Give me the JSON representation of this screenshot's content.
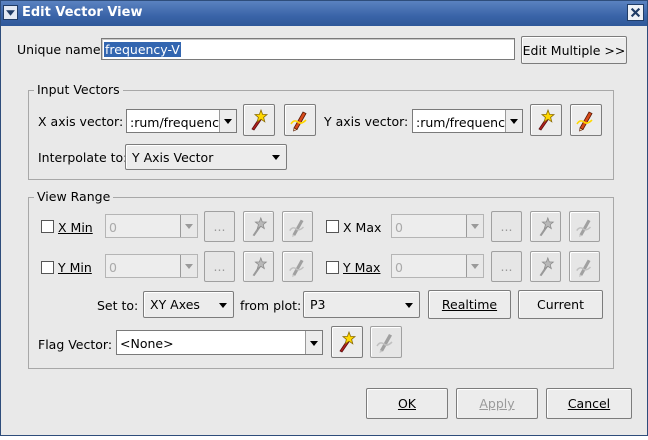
{
  "window": {
    "title": "Edit Vector View"
  },
  "unique_name": {
    "label": "Unique name:",
    "value": "frequency-V"
  },
  "edit_multiple_label": "Edit Multiple >>",
  "input_vectors": {
    "legend": "Input Vectors",
    "x_label": "X axis vector:",
    "x_value": ":rum/frequency",
    "y_label": "Y axis vector:",
    "y_value": ":rum/frequency",
    "interp_label": "Interpolate to:",
    "interp_value": "Y Axis Vector"
  },
  "view_range": {
    "legend": "View Range",
    "x_min_label": "X Min",
    "x_min_value": "0",
    "x_max_label": "X Max",
    "x_max_value": "0",
    "y_min_label": "Y Min",
    "y_min_value": "0",
    "y_max_label": "Y Max",
    "y_max_value": "0",
    "dots": "...",
    "set_to_label": "Set to:",
    "set_to_value": "XY Axes",
    "from_plot_label": "from plot:",
    "from_plot_value": "P3",
    "realtime_label": "Realtime",
    "current_label": "Current"
  },
  "flag_vector": {
    "label": "Flag Vector:",
    "value": "<None>"
  },
  "buttons": {
    "ok": "OK",
    "apply": "Apply",
    "cancel": "Cancel"
  },
  "icons": {
    "wizard": "wand-star-icon",
    "edit": "pencil-icon",
    "close": "close-icon",
    "menu": "window-menu-icon",
    "dropdown": "chevron-down-icon"
  },
  "colors": {
    "title_bar": "#3a64a8",
    "selection": "#3366b0",
    "dialog_bg": "#e9e9e9"
  }
}
